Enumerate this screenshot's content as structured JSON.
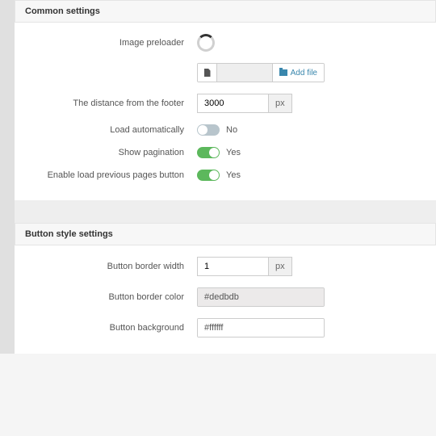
{
  "sections": {
    "common": {
      "title": "Common settings",
      "image_preloader_label": "Image preloader",
      "add_file_label": "Add file",
      "distance_label": "The distance from the footer",
      "distance_value": "3000",
      "distance_unit": "px",
      "load_auto_label": "Load automatically",
      "load_auto_state": "No",
      "show_pagination_label": "Show pagination",
      "show_pagination_state": "Yes",
      "enable_prev_label": "Enable load previous pages button",
      "enable_prev_state": "Yes"
    },
    "button_style": {
      "title": "Button style settings",
      "border_width_label": "Button border width",
      "border_width_value": "1",
      "border_width_unit": "px",
      "border_color_label": "Button border color",
      "border_color_value": "#dedbdb",
      "background_label": "Button background",
      "background_value": "#ffffff"
    }
  }
}
